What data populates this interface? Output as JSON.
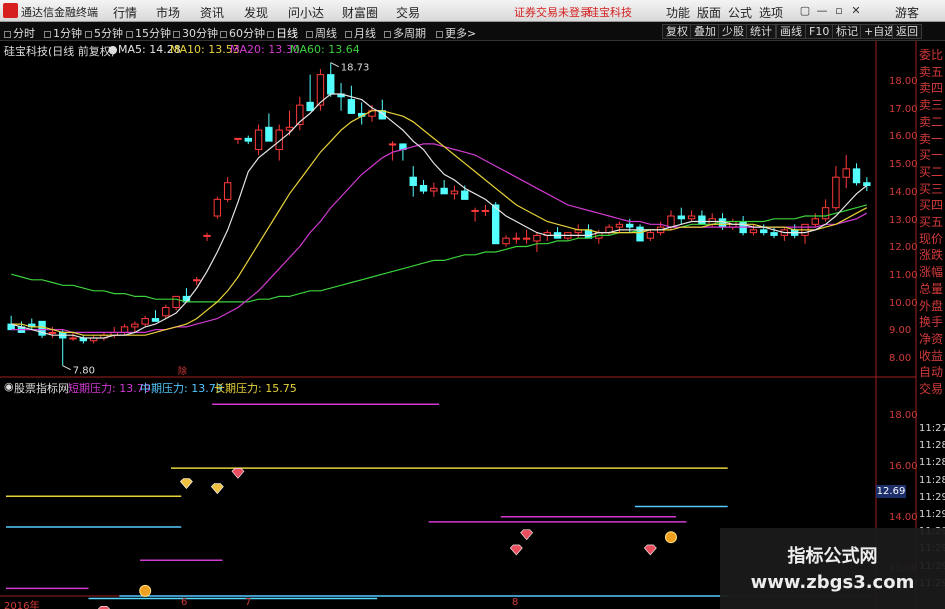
{
  "menubar": {
    "app_name": "通达信金融终端",
    "items": [
      "行情",
      "市场",
      "资讯",
      "发现",
      "问小达",
      "财富圈",
      "交易"
    ],
    "notice": "证券交易未登录",
    "stock": "硅宝科技",
    "right_items": [
      "功能",
      "版面",
      "公式",
      "选项"
    ],
    "window_buttons": [
      "▢",
      "—",
      "▫",
      "✕"
    ],
    "guest": "游客"
  },
  "periodbar": {
    "periods": [
      "分时",
      "1分钟",
      "5分钟",
      "15分钟",
      "30分钟",
      "60分钟",
      "日线",
      "周线",
      "月线",
      "多周期",
      "更多"
    ],
    "more_suffix": "更多>",
    "active": "日线",
    "right_buttons": [
      "复权",
      "叠加",
      "少股",
      "统计",
      "画线",
      "F10",
      "标记",
      "+自选",
      "返回"
    ]
  },
  "ma_legend": {
    "title": "硅宝科技(日线 前复权)",
    "ma5": "MA5: 14.28",
    "ma10": "MA10: 13.53",
    "ma20": "MA20: 13.30",
    "ma60": "MA60: 13.64"
  },
  "colors": {
    "up": "#ff3a3a",
    "down": "#54ffff",
    "ma5": "#e5e5e5",
    "ma10": "#e8d23a",
    "ma20": "#d23ad2",
    "ma60": "#3ad23a",
    "axis": "#d23a3a"
  },
  "price_axis": [
    "18.00",
    "17.00",
    "16.00",
    "15.00",
    "14.00",
    "13.00",
    "12.00",
    "11.00",
    "10.00",
    "9.00",
    "8.00"
  ],
  "indicator_axis": [
    "18.00",
    "16.00",
    "14.00",
    "12.00"
  ],
  "right_panel": {
    "labels": [
      "委比",
      "卖五",
      "卖四",
      "卖三",
      "卖二",
      "卖一",
      "买一",
      "买二",
      "买三",
      "买四",
      "买五",
      "现价",
      "涨跌",
      "涨幅",
      "总量",
      "外盘",
      "换手",
      "净资",
      "收益",
      "自动",
      "交易"
    ],
    "times": [
      "11:27",
      "11:28",
      "11:28",
      "11:28",
      "11:29",
      "11:29",
      "11:29",
      "11:29",
      "11:29",
      "11:29"
    ]
  },
  "indicator_legend": {
    "name": "股票指标网",
    "short": "短期压力: 13.79",
    "mid": "中期压力: 13.79",
    "long": "长期压力: 15.75"
  },
  "annotations": {
    "high": "18.73",
    "low": "7.80",
    "current_price": "12.69",
    "ex_marker": "除"
  },
  "date_axis": [
    "2016年",
    "6",
    "7",
    "8"
  ],
  "watermark": {
    "line1": "指标公式网",
    "line2": "www.zbgs3.com"
  },
  "chart_data": {
    "type": "candlestick",
    "ylim": [
      7.5,
      18.9
    ],
    "ohlc": [
      [
        9.3,
        9.6,
        9.2,
        9.1
      ],
      [
        9.2,
        9.4,
        9.1,
        9.0
      ],
      [
        9.3,
        9.5,
        9.1,
        9.2
      ],
      [
        9.4,
        9.4,
        8.8,
        8.9
      ],
      [
        9.0,
        9.2,
        8.8,
        9.0
      ],
      [
        9.0,
        9.1,
        7.8,
        8.8
      ],
      [
        8.8,
        9.0,
        8.7,
        8.8
      ],
      [
        8.8,
        8.9,
        8.6,
        8.7
      ],
      [
        8.7,
        8.9,
        8.6,
        8.8
      ],
      [
        8.8,
        9.0,
        8.7,
        8.9
      ],
      [
        8.9,
        9.2,
        8.8,
        9.0
      ],
      [
        9.0,
        9.3,
        8.9,
        9.2
      ],
      [
        9.2,
        9.4,
        9.0,
        9.3
      ],
      [
        9.3,
        9.6,
        9.2,
        9.5
      ],
      [
        9.5,
        9.8,
        9.4,
        9.4
      ],
      [
        9.6,
        10.0,
        9.5,
        9.9
      ],
      [
        9.9,
        10.3,
        9.8,
        10.3
      ],
      [
        10.3,
        10.6,
        10.2,
        10.1
      ],
      [
        10.9,
        11.0,
        10.7,
        10.9
      ],
      [
        12.5,
        12.6,
        12.3,
        12.5
      ],
      [
        13.2,
        13.9,
        13.1,
        13.8
      ],
      [
        13.8,
        14.6,
        13.7,
        14.4
      ],
      [
        16.0,
        16.0,
        15.8,
        16.0
      ],
      [
        16.0,
        16.1,
        15.8,
        15.9
      ],
      [
        15.6,
        16.5,
        15.4,
        16.3
      ],
      [
        16.4,
        16.9,
        16.2,
        15.9
      ],
      [
        15.6,
        16.5,
        15.2,
        16.3
      ],
      [
        16.3,
        17.0,
        16.1,
        16.4
      ],
      [
        16.5,
        17.5,
        16.3,
        17.2
      ],
      [
        17.3,
        18.3,
        17.1,
        17.0
      ],
      [
        17.2,
        18.5,
        17.0,
        18.3
      ],
      [
        18.3,
        18.73,
        17.5,
        17.6
      ],
      [
        17.6,
        18.0,
        17.0,
        17.5
      ],
      [
        17.4,
        17.9,
        16.9,
        16.9
      ],
      [
        16.9,
        17.3,
        16.5,
        16.8
      ],
      [
        16.8,
        17.2,
        16.6,
        17.0
      ],
      [
        17.0,
        17.4,
        16.8,
        16.7
      ],
      [
        15.8,
        15.9,
        15.2,
        15.8
      ],
      [
        15.8,
        15.8,
        15.2,
        15.6
      ],
      [
        14.6,
        15.0,
        13.9,
        14.3
      ],
      [
        14.3,
        14.5,
        14.0,
        14.1
      ],
      [
        14.1,
        14.4,
        13.9,
        14.2
      ],
      [
        14.2,
        14.5,
        14.0,
        14.0
      ],
      [
        14.0,
        14.3,
        13.8,
        14.1
      ],
      [
        14.1,
        14.3,
        13.9,
        13.8
      ],
      [
        13.4,
        13.5,
        13.0,
        13.4
      ],
      [
        13.4,
        13.6,
        13.2,
        13.4
      ],
      [
        13.6,
        13.7,
        12.2,
        12.2
      ],
      [
        12.2,
        12.5,
        12.1,
        12.4
      ],
      [
        12.4,
        12.6,
        12.2,
        12.4
      ],
      [
        12.4,
        12.7,
        12.2,
        12.4
      ],
      [
        12.3,
        12.6,
        11.9,
        12.5
      ],
      [
        12.5,
        12.7,
        12.3,
        12.6
      ],
      [
        12.6,
        12.8,
        12.4,
        12.4
      ],
      [
        12.4,
        12.6,
        12.3,
        12.6
      ],
      [
        12.6,
        12.9,
        12.4,
        12.7
      ],
      [
        12.7,
        12.9,
        12.4,
        12.4
      ],
      [
        12.4,
        12.7,
        12.2,
        12.6
      ],
      [
        12.6,
        12.9,
        12.5,
        12.8
      ],
      [
        12.8,
        13.0,
        12.6,
        12.9
      ],
      [
        12.9,
        13.1,
        12.6,
        12.8
      ],
      [
        12.8,
        12.9,
        12.3,
        12.3
      ],
      [
        12.4,
        12.7,
        12.3,
        12.6
      ],
      [
        12.6,
        13.0,
        12.5,
        12.8
      ],
      [
        12.8,
        13.4,
        12.7,
        13.2
      ],
      [
        13.2,
        13.5,
        12.9,
        13.1
      ],
      [
        13.1,
        13.4,
        13.0,
        13.2
      ],
      [
        13.2,
        13.4,
        12.9,
        12.9
      ],
      [
        12.9,
        13.3,
        12.8,
        13.1
      ],
      [
        13.1,
        13.3,
        12.7,
        12.8
      ],
      [
        12.8,
        13.1,
        12.7,
        13.0
      ],
      [
        13.0,
        13.2,
        12.5,
        12.6
      ],
      [
        12.6,
        12.9,
        12.5,
        12.7
      ],
      [
        12.7,
        12.9,
        12.5,
        12.6
      ],
      [
        12.6,
        12.8,
        12.4,
        12.5
      ],
      [
        12.5,
        12.8,
        12.3,
        12.7
      ],
      [
        12.7,
        12.9,
        12.4,
        12.5
      ],
      [
        12.5,
        12.9,
        12.2,
        12.9
      ],
      [
        12.9,
        13.3,
        12.8,
        13.1
      ],
      [
        13.1,
        13.8,
        13.0,
        13.5
      ],
      [
        13.5,
        15.0,
        13.4,
        14.6
      ],
      [
        14.6,
        15.4,
        14.2,
        14.9
      ],
      [
        14.9,
        15.1,
        14.3,
        14.4
      ],
      [
        14.4,
        14.6,
        14.1,
        14.3
      ]
    ],
    "ma5": [
      9.3,
      9.2,
      9.1,
      9.0,
      8.9,
      8.9,
      8.9,
      8.8,
      8.8,
      8.8,
      8.9,
      8.9,
      9.0,
      9.2,
      9.3,
      9.5,
      9.7,
      10.1,
      10.6,
      11.2,
      11.9,
      12.7,
      13.7,
      14.8,
      15.3,
      15.6,
      15.9,
      16.2,
      16.6,
      16.9,
      17.3,
      17.6,
      17.6,
      17.5,
      17.4,
      17.1,
      16.9,
      16.6,
      16.3,
      15.9,
      15.6,
      15.1,
      14.7,
      14.5,
      14.2,
      14.0,
      13.8,
      13.5,
      13.2,
      13.0,
      12.8,
      12.6,
      12.5,
      12.5,
      12.5,
      12.5,
      12.5,
      12.6,
      12.6,
      12.7,
      12.7,
      12.7,
      12.7,
      12.7,
      12.8,
      12.9,
      13.0,
      13.0,
      13.0,
      13.0,
      12.9,
      12.9,
      12.8,
      12.8,
      12.7,
      12.6,
      12.6,
      12.6,
      12.7,
      12.9,
      13.2,
      13.6,
      14.0,
      14.3
    ],
    "ma10": [
      9.3,
      9.3,
      9.2,
      9.2,
      9.1,
      9.0,
      9.0,
      8.9,
      8.9,
      8.9,
      8.9,
      8.9,
      8.9,
      8.9,
      9.0,
      9.1,
      9.2,
      9.3,
      9.5,
      9.8,
      10.1,
      10.5,
      11.0,
      11.6,
      12.2,
      12.8,
      13.4,
      14.0,
      14.5,
      15.0,
      15.5,
      15.9,
      16.3,
      16.6,
      16.8,
      17.0,
      17.0,
      16.9,
      16.8,
      16.6,
      16.3,
      16.0,
      15.7,
      15.4,
      15.1,
      14.8,
      14.5,
      14.2,
      13.9,
      13.6,
      13.4,
      13.2,
      13.0,
      12.9,
      12.8,
      12.7,
      12.7,
      12.6,
      12.6,
      12.6,
      12.6,
      12.6,
      12.7,
      12.7,
      12.7,
      12.8,
      12.8,
      12.8,
      12.9,
      12.9,
      12.9,
      12.9,
      12.9,
      12.8,
      12.8,
      12.8,
      12.7,
      12.7,
      12.7,
      12.8,
      12.9,
      13.1,
      13.3,
      13.5
    ],
    "ma20": [
      9.1,
      9.1,
      9.1,
      9.1,
      9.1,
      9.1,
      9.0,
      9.0,
      9.0,
      9.0,
      9.0,
      9.0,
      9.0,
      9.0,
      9.1,
      9.1,
      9.2,
      9.2,
      9.3,
      9.4,
      9.5,
      9.7,
      9.9,
      10.2,
      10.5,
      10.9,
      11.3,
      11.7,
      12.1,
      12.6,
      13.0,
      13.5,
      13.9,
      14.3,
      14.7,
      15.0,
      15.3,
      15.5,
      15.6,
      15.7,
      15.8,
      15.8,
      15.7,
      15.6,
      15.5,
      15.4,
      15.2,
      15.0,
      14.8,
      14.6,
      14.4,
      14.2,
      14.0,
      13.8,
      13.6,
      13.5,
      13.4,
      13.3,
      13.2,
      13.1,
      13.0,
      13.0,
      12.9,
      12.9,
      12.8,
      12.8,
      12.8,
      12.8,
      12.8,
      12.8,
      12.8,
      12.8,
      12.8,
      12.8,
      12.8,
      12.8,
      12.8,
      12.8,
      12.8,
      12.9,
      12.9,
      13.0,
      13.1,
      13.3
    ],
    "ma60": [
      11.1,
      11.0,
      10.9,
      10.9,
      10.8,
      10.7,
      10.7,
      10.6,
      10.5,
      10.5,
      10.4,
      10.4,
      10.3,
      10.3,
      10.2,
      10.2,
      10.2,
      10.1,
      10.1,
      10.1,
      10.1,
      10.1,
      10.1,
      10.1,
      10.2,
      10.2,
      10.3,
      10.3,
      10.4,
      10.5,
      10.5,
      10.6,
      10.7,
      10.8,
      10.9,
      11.0,
      11.1,
      11.2,
      11.3,
      11.4,
      11.5,
      11.6,
      11.6,
      11.7,
      11.8,
      11.8,
      11.9,
      11.9,
      12.0,
      12.1,
      12.1,
      12.2,
      12.2,
      12.3,
      12.3,
      12.4,
      12.4,
      12.5,
      12.5,
      12.6,
      12.6,
      12.7,
      12.7,
      12.7,
      12.8,
      12.8,
      12.9,
      12.9,
      12.9,
      13.0,
      13.0,
      13.0,
      13.0,
      13.0,
      13.1,
      13.1,
      13.1,
      13.2,
      13.2,
      13.2,
      13.3,
      13.4,
      13.5,
      13.6
    ],
    "indicator": {
      "ylim": [
        11.0,
        18.9
      ],
      "segments": [
        {
          "series": "short",
          "x0": 0,
          "x1": 8,
          "y": 11.3,
          "color": "#d23ad2"
        },
        {
          "series": "long",
          "x0": 8,
          "x1": 36,
          "y": 10.9,
          "color": "#54d8ff"
        },
        {
          "series": "mid",
          "x0": 0,
          "x1": 17,
          "y": 13.7,
          "color": "#54c8ff"
        },
        {
          "series": "short",
          "x0": 13,
          "x1": 21,
          "y": 12.4,
          "color": "#d23ad2"
        },
        {
          "series": "long",
          "x0": 0,
          "x1": 17,
          "y": 14.9,
          "color": "#e8d23a"
        },
        {
          "series": "long",
          "x0": 16,
          "x1": 70,
          "y": 16.0,
          "color": "#e8d23a"
        },
        {
          "series": "short",
          "x0": 20,
          "x1": 42,
          "y": 18.5,
          "color": "#d23ad2"
        },
        {
          "series": "short",
          "x0": 41,
          "x1": 66,
          "y": 13.9,
          "color": "#d23ad2"
        },
        {
          "series": "short",
          "x0": 48,
          "x1": 65,
          "y": 14.1,
          "color": "#d23ad2"
        },
        {
          "series": "mid",
          "x0": 11,
          "x1": 70,
          "y": 11.0,
          "color": "#54c8ff"
        },
        {
          "series": "mid",
          "x0": 61,
          "x1": 70,
          "y": 14.5,
          "color": "#54c8ff"
        }
      ],
      "markers": [
        {
          "x": 17,
          "y": 15.4,
          "kind": "gold-diamond"
        },
        {
          "x": 20,
          "y": 15.2,
          "kind": "gold-diamond"
        },
        {
          "x": 22,
          "y": 15.8,
          "kind": "red-diamond"
        },
        {
          "x": 9,
          "y": 10.4,
          "kind": "red-diamond"
        },
        {
          "x": 13,
          "y": 11.2,
          "kind": "gold-coin"
        },
        {
          "x": 49,
          "y": 12.8,
          "kind": "red-diamond"
        },
        {
          "x": 50,
          "y": 13.4,
          "kind": "red-diamond"
        },
        {
          "x": 62,
          "y": 12.8,
          "kind": "red-diamond"
        },
        {
          "x": 64,
          "y": 13.3,
          "kind": "gold-coin"
        }
      ]
    }
  }
}
